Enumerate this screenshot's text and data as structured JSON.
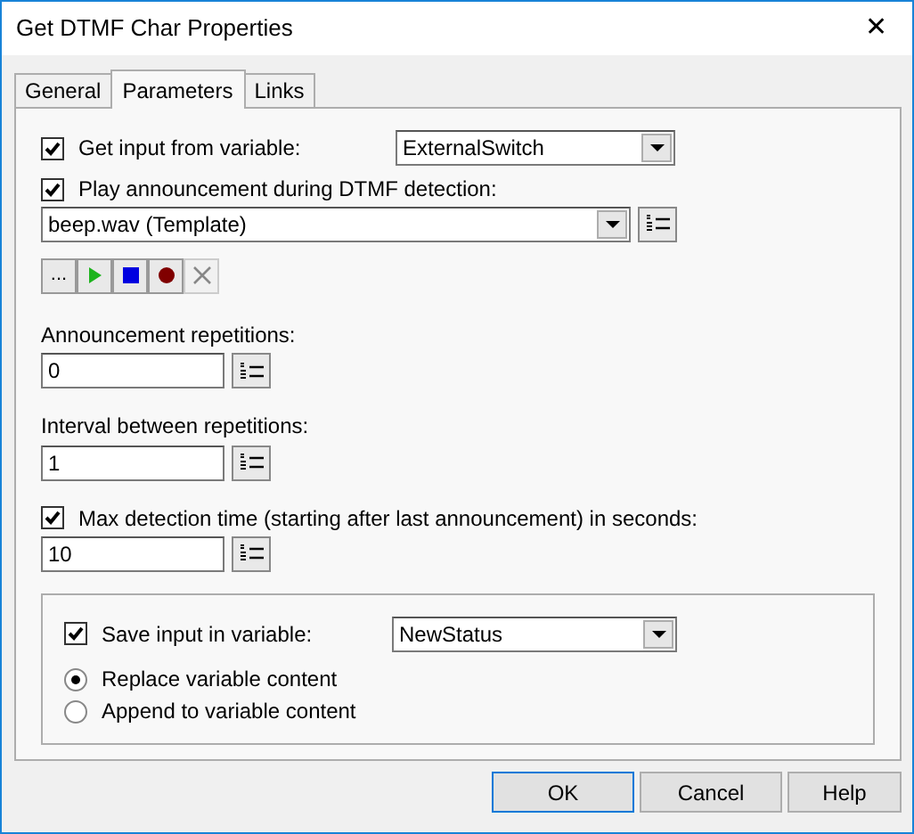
{
  "window": {
    "title": "Get DTMF Char Properties",
    "close": "✕"
  },
  "tabs": [
    {
      "label": "General",
      "selected": false
    },
    {
      "label": "Parameters",
      "selected": true
    },
    {
      "label": "Links",
      "selected": false
    }
  ],
  "get_input": {
    "label": "Get input from variable:",
    "checked": true,
    "value": "ExternalSwitch"
  },
  "announcement": {
    "label": "Play announcement during DTMF detection:",
    "checked": true,
    "value": "beep.wav (Template)"
  },
  "tools": [
    {
      "kind": "browse",
      "label": "...",
      "disabled": false
    },
    {
      "kind": "play",
      "disabled": false
    },
    {
      "kind": "stop",
      "disabled": false
    },
    {
      "kind": "record",
      "disabled": false
    },
    {
      "kind": "delete",
      "disabled": true
    }
  ],
  "repetitions": {
    "label": "Announcement repetitions:",
    "value": "0"
  },
  "interval": {
    "label": "Interval between repetitions:",
    "value": "1"
  },
  "max_time": {
    "label": "Max detection time (starting after last announcement) in seconds:",
    "checked": true,
    "value": "10"
  },
  "save": {
    "label": "Save input in variable:",
    "checked": true,
    "value": "NewStatus",
    "options": [
      {
        "label": "Replace variable content",
        "selected": true
      },
      {
        "label": "Append to variable content",
        "selected": false
      }
    ]
  },
  "buttons": [
    "OK",
    "Cancel",
    "Help"
  ]
}
